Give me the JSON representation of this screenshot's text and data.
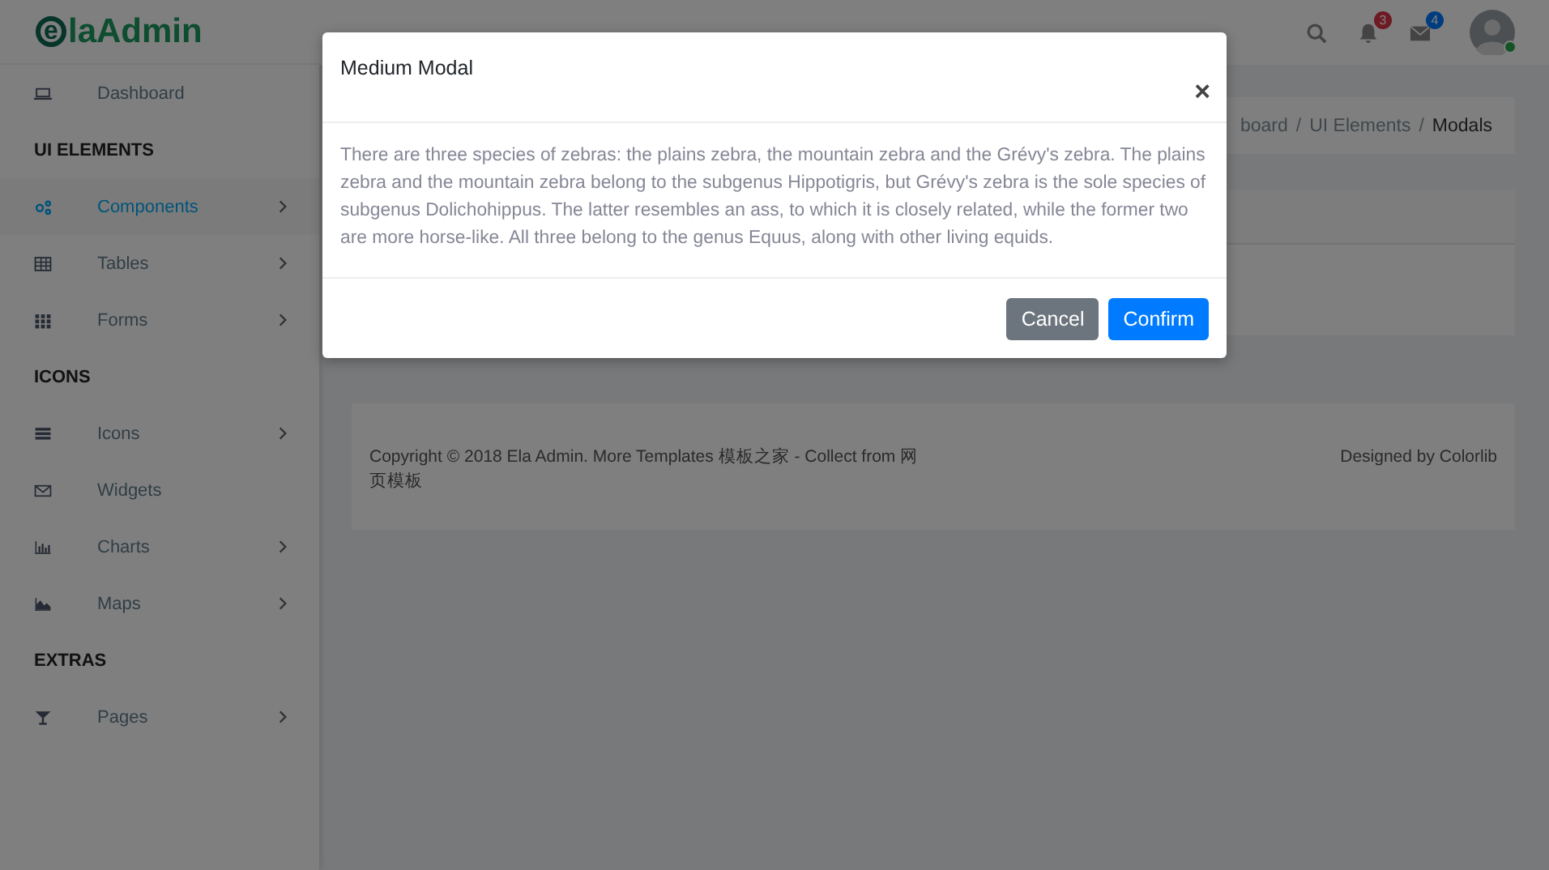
{
  "logo": {
    "mark": "e",
    "text": "laAdmin"
  },
  "sidebar": {
    "items": [
      {
        "kind": "link",
        "label": "Dashboard",
        "selected": false,
        "submenu": false
      },
      {
        "kind": "heading",
        "label": "UI ELEMENTS"
      },
      {
        "kind": "link",
        "label": "Components",
        "selected": true,
        "submenu": true
      },
      {
        "kind": "link",
        "label": "Tables",
        "selected": false,
        "submenu": true
      },
      {
        "kind": "link",
        "label": "Forms",
        "selected": false,
        "submenu": true
      },
      {
        "kind": "heading",
        "label": "ICONS"
      },
      {
        "kind": "link",
        "label": "Icons",
        "selected": false,
        "submenu": true
      },
      {
        "kind": "link",
        "label": "Widgets",
        "selected": false,
        "submenu": false
      },
      {
        "kind": "link",
        "label": "Charts",
        "selected": false,
        "submenu": true
      },
      {
        "kind": "link",
        "label": "Maps",
        "selected": false,
        "submenu": true
      },
      {
        "kind": "heading",
        "label": "EXTRAS"
      },
      {
        "kind": "link",
        "label": "Pages",
        "selected": false,
        "submenu": true
      }
    ]
  },
  "header": {
    "notifications": {
      "count": "3"
    },
    "messages": {
      "count": "4"
    },
    "user": {
      "online": true
    }
  },
  "breadcrumb": {
    "separator": "/",
    "items": [
      {
        "label": "board",
        "selected": false
      },
      {
        "label": "UI Elements",
        "selected": false
      },
      {
        "label": "Modals",
        "selected": true
      }
    ]
  },
  "footer": {
    "copyright": "Copyright © 2018 Ela Admin. More Templates 模板之家 - Collect from 网页模板",
    "credit": "Designed by Colorlib"
  },
  "modal": {
    "title": "Medium Modal",
    "close": "×",
    "body": "There are three species of zebras: the plains zebra, the mountain zebra and the Grévy's zebra. The plains zebra and the mountain zebra belong to the subgenus Hippotigris, but Grévy's zebra is the sole species of subgenus Dolichohippus. The latter resembles an ass, to which it is closely related, while the former two are more horse-like. All three belong to the genus Equus, along with other living equids.",
    "buttons": [
      {
        "label": "Cancel",
        "kind": "secondary"
      },
      {
        "label": "Confirm",
        "kind": "primary"
      }
    ]
  }
}
